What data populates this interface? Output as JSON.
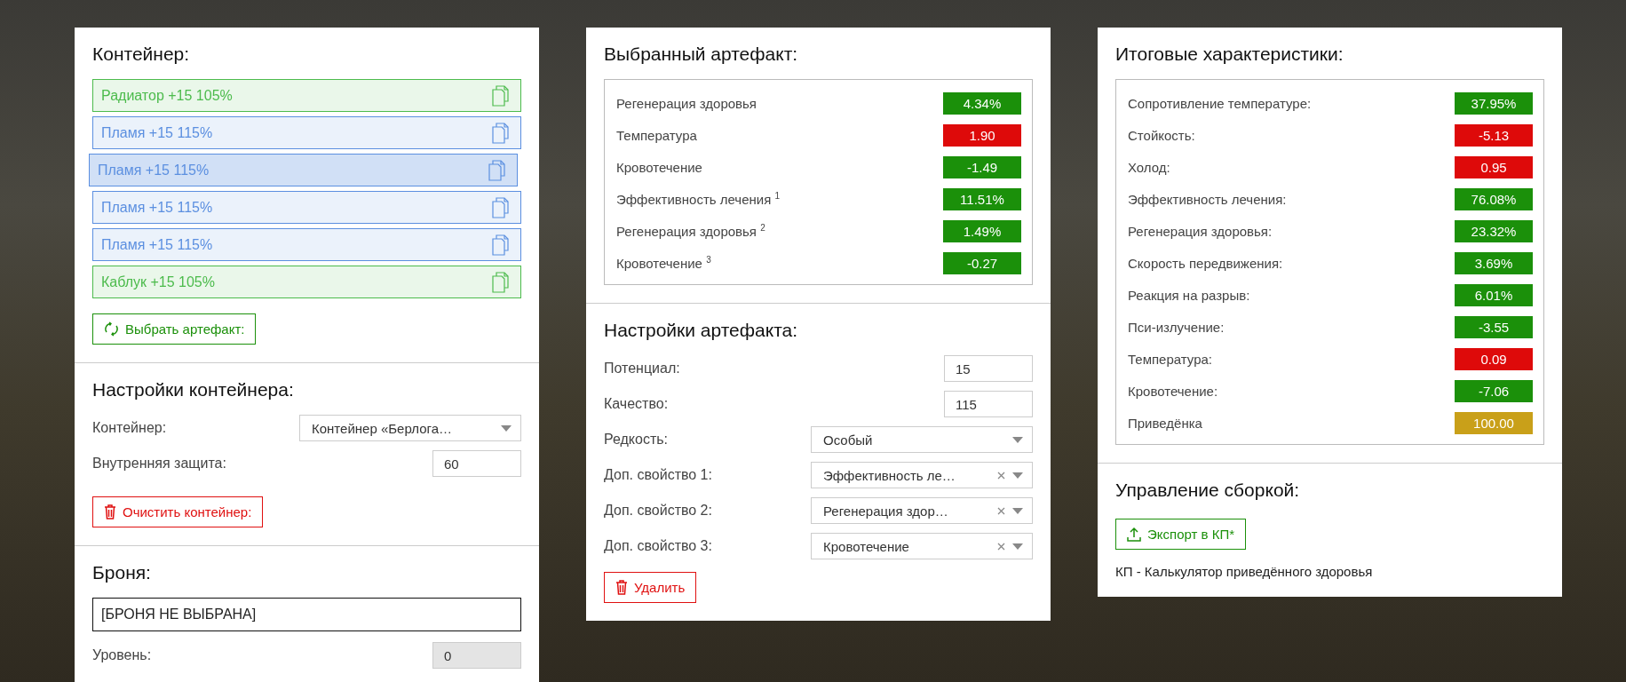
{
  "container": {
    "title": "Контейнер:",
    "artifacts": [
      {
        "label": "Радиатор +15 105%",
        "color": "#4cbb4c",
        "selected": false
      },
      {
        "label": "Пламя +15 115%",
        "color": "#5b8fe0",
        "selected": false
      },
      {
        "label": "Пламя +15 115%",
        "color": "#5b8fe0",
        "selected": true
      },
      {
        "label": "Пламя +15 115%",
        "color": "#5b8fe0",
        "selected": false
      },
      {
        "label": "Пламя +15 115%",
        "color": "#5b8fe0",
        "selected": false
      },
      {
        "label": "Каблук +15 105%",
        "color": "#4cbb4c",
        "selected": false
      }
    ],
    "select_button": "Выбрать артефакт:"
  },
  "container_settings": {
    "title": "Настройки контейнера:",
    "fields": [
      {
        "label": "Контейнер:",
        "kind": "select",
        "value": "Контейнер «Берлога…",
        "clearable": false,
        "disabled": false
      },
      {
        "label": "Внутренняя защита:",
        "kind": "number",
        "value": "60",
        "disabled": false
      }
    ],
    "clear_button": "Очистить контейнер:"
  },
  "armor": {
    "title": "Броня:",
    "value": "[БРОНЯ НЕ ВЫБРАНА]",
    "fields": [
      {
        "label": "Уровень:",
        "kind": "number",
        "value": "0",
        "disabled": true
      }
    ]
  },
  "selected_artifact": {
    "title": "Выбранный артефакт:",
    "stats": [
      {
        "label": "Регенерация здоровья",
        "value": "4.34%",
        "color": "#1b900a"
      },
      {
        "label": "Температура",
        "value": "1.90",
        "color": "#de0a0a"
      },
      {
        "label": "Кровотечение",
        "value": "-1.49",
        "color": "#1b900a"
      },
      {
        "label": "Эффективность лечения $^{1}$",
        "value": "11.51%",
        "color": "#1b900a"
      },
      {
        "label": "Регенерация здоровья $^{2}$",
        "value": "1.49%",
        "color": "#1b900a"
      },
      {
        "label": "Кровотечение $^{3}$",
        "value": "-0.27",
        "color": "#1b900a"
      }
    ]
  },
  "artifact_settings": {
    "title": "Настройки артефакта:",
    "fields": [
      {
        "label": "Потенциал:",
        "kind": "number",
        "value": "15",
        "disabled": false
      },
      {
        "label": "Качество:",
        "kind": "number",
        "value": "115",
        "disabled": false
      },
      {
        "label": "Редкость:",
        "kind": "select",
        "value": "Особый",
        "clearable": false,
        "disabled": false
      },
      {
        "label": "Доп. свойство 1:",
        "kind": "select",
        "value": "Эффективность ле…",
        "clearable": true,
        "disabled": false
      },
      {
        "label": "Доп. свойство 2:",
        "kind": "select",
        "value": "Регенерация здор…",
        "clearable": true,
        "disabled": false
      },
      {
        "label": "Доп. свойство 3:",
        "kind": "select",
        "value": "Кровотечение",
        "clearable": true,
        "disabled": false
      }
    ],
    "delete_button": "Удалить"
  },
  "totals": {
    "title": "Итоговые характеристики:",
    "stats": [
      {
        "label": "Сопротивление температуре:",
        "value": "37.95%",
        "color": "#1b900a"
      },
      {
        "label": "Стойкость:",
        "value": "-5.13",
        "color": "#de0a0a"
      },
      {
        "label": "Холод:",
        "value": "0.95",
        "color": "#de0a0a"
      },
      {
        "label": "Эффективность лечения:",
        "value": "76.08%",
        "color": "#1b900a"
      },
      {
        "label": "Регенерация здоровья:",
        "value": "23.32%",
        "color": "#1b900a"
      },
      {
        "label": "Скорость передвижения:",
        "value": "3.69%",
        "color": "#1b900a"
      },
      {
        "label": "Реакция на разрыв:",
        "value": "6.01%",
        "color": "#1b900a"
      },
      {
        "label": "Пси-излучение:",
        "value": "-3.55",
        "color": "#1b900a"
      },
      {
        "label": "Температура:",
        "value": "0.09",
        "color": "#de0a0a"
      },
      {
        "label": "Кровотечение:",
        "value": "-7.06",
        "color": "#1b900a"
      },
      {
        "label": "Приведёнка",
        "value": "100.00",
        "color": "#c9a019"
      }
    ]
  },
  "build": {
    "title": "Управление сборкой:",
    "export_button": "Экспорт в КП*",
    "note": "КП - Калькулятор приведённого здоровья"
  }
}
